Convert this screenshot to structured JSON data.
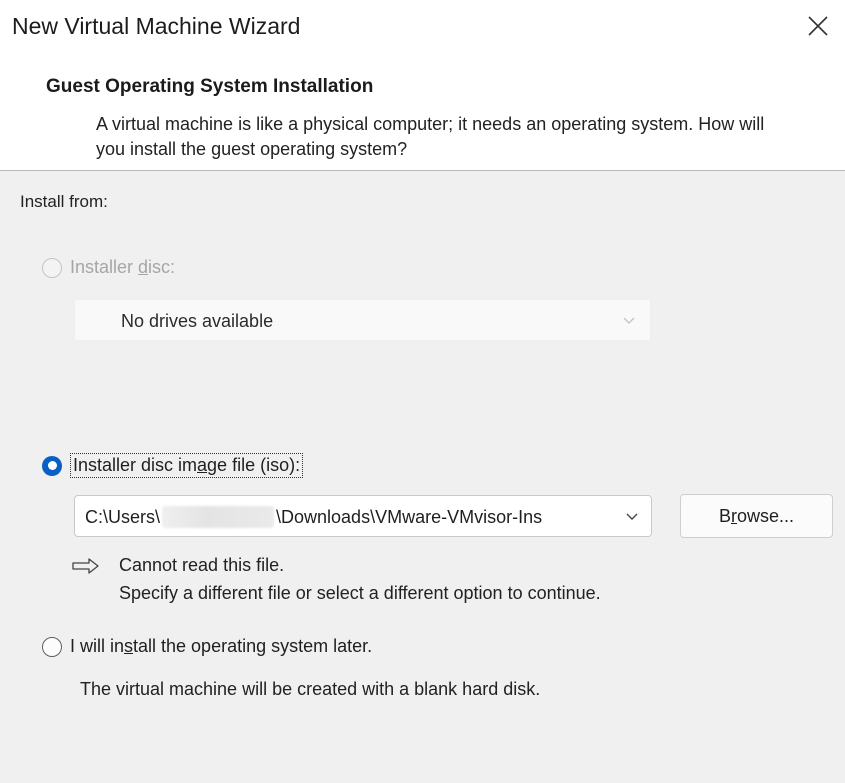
{
  "window": {
    "title": "New Virtual Machine Wizard"
  },
  "header": {
    "title": "Guest Operating System Installation",
    "description": "A virtual machine is like a physical computer; it needs an operating system. How will you install the guest operating system?"
  },
  "install_from": {
    "label": "Install from:",
    "installer_disc": {
      "label_pre": "Installer ",
      "label_accel": "d",
      "label_post": "isc:",
      "selected": false,
      "enabled": false,
      "dropdown_value": "No drives available"
    },
    "iso": {
      "label_pre": "Installer disc im",
      "label_accel": "a",
      "label_post": "ge file (iso):",
      "selected": true,
      "path_prefix": "C:\\Users\\",
      "path_suffix": "\\Downloads\\VMware-VMvisor-Ins",
      "browse_pre": "B",
      "browse_accel": "r",
      "browse_post": "owse...",
      "warning_line1": "Cannot read this file.",
      "warning_line2": "Specify a different file or select a different option to continue."
    },
    "later": {
      "label_pre": "I will in",
      "label_accel": "s",
      "label_post": "tall the operating system later.",
      "selected": false,
      "description": "The virtual machine will be created with a blank hard disk."
    }
  },
  "colors": {
    "accent": "#0a5fc4",
    "body_bg": "#f0f0f0",
    "header_bg": "#ffffff"
  },
  "icons": {
    "close": "close-icon",
    "chevron": "chevron-down-icon",
    "warning_arrow": "arrow-right-icon"
  }
}
